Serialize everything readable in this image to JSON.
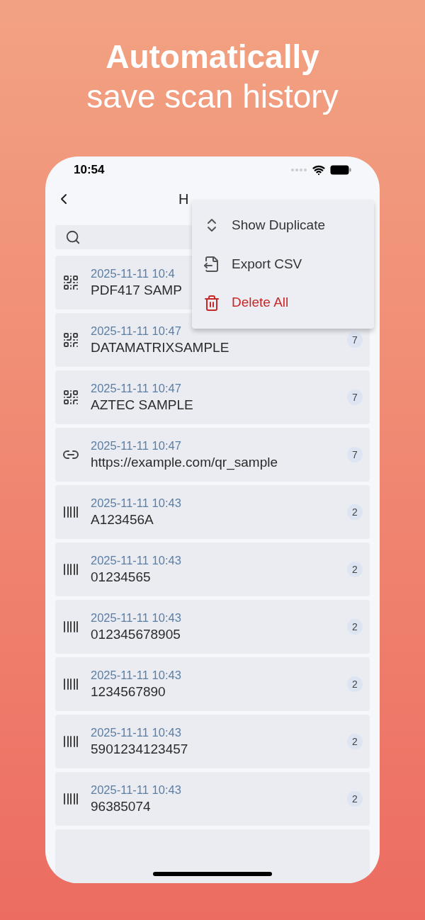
{
  "headline": {
    "line_1": "Automatically",
    "line_2": "save scan history"
  },
  "status_bar": {
    "time": "10:54"
  },
  "header": {
    "title": "H"
  },
  "menu": {
    "items": [
      {
        "kind": "duplicate",
        "label": "Show Duplicate"
      },
      {
        "kind": "export",
        "label": "Export CSV"
      },
      {
        "kind": "delete",
        "label": "Delete All"
      }
    ]
  },
  "history": [
    {
      "kind": "qr",
      "date": "2025-11-11 10:4",
      "value": "PDF417 SAMP"
    },
    {
      "kind": "qr",
      "date": "2025-11-11 10:47",
      "value": "DATAMATRIXSAMPLE",
      "count": "7"
    },
    {
      "kind": "qr",
      "date": "2025-11-11 10:47",
      "value": "AZTEC SAMPLE",
      "count": "7"
    },
    {
      "kind": "link",
      "date": "2025-11-11 10:47",
      "value": "https://example.com/qr_sample",
      "count": "7"
    },
    {
      "kind": "barcode",
      "date": "2025-11-11 10:43",
      "value": "A123456A",
      "count": "2"
    },
    {
      "kind": "barcode",
      "date": "2025-11-11 10:43",
      "value": "01234565",
      "count": "2"
    },
    {
      "kind": "barcode",
      "date": "2025-11-11 10:43",
      "value": "012345678905",
      "count": "2"
    },
    {
      "kind": "barcode",
      "date": "2025-11-11 10:43",
      "value": "1234567890",
      "count": "2"
    },
    {
      "kind": "barcode",
      "date": "2025-11-11 10:43",
      "value": "5901234123457",
      "count": "2"
    },
    {
      "kind": "barcode",
      "date": "2025-11-11 10:43",
      "value": "96385074",
      "count": "2"
    }
  ]
}
